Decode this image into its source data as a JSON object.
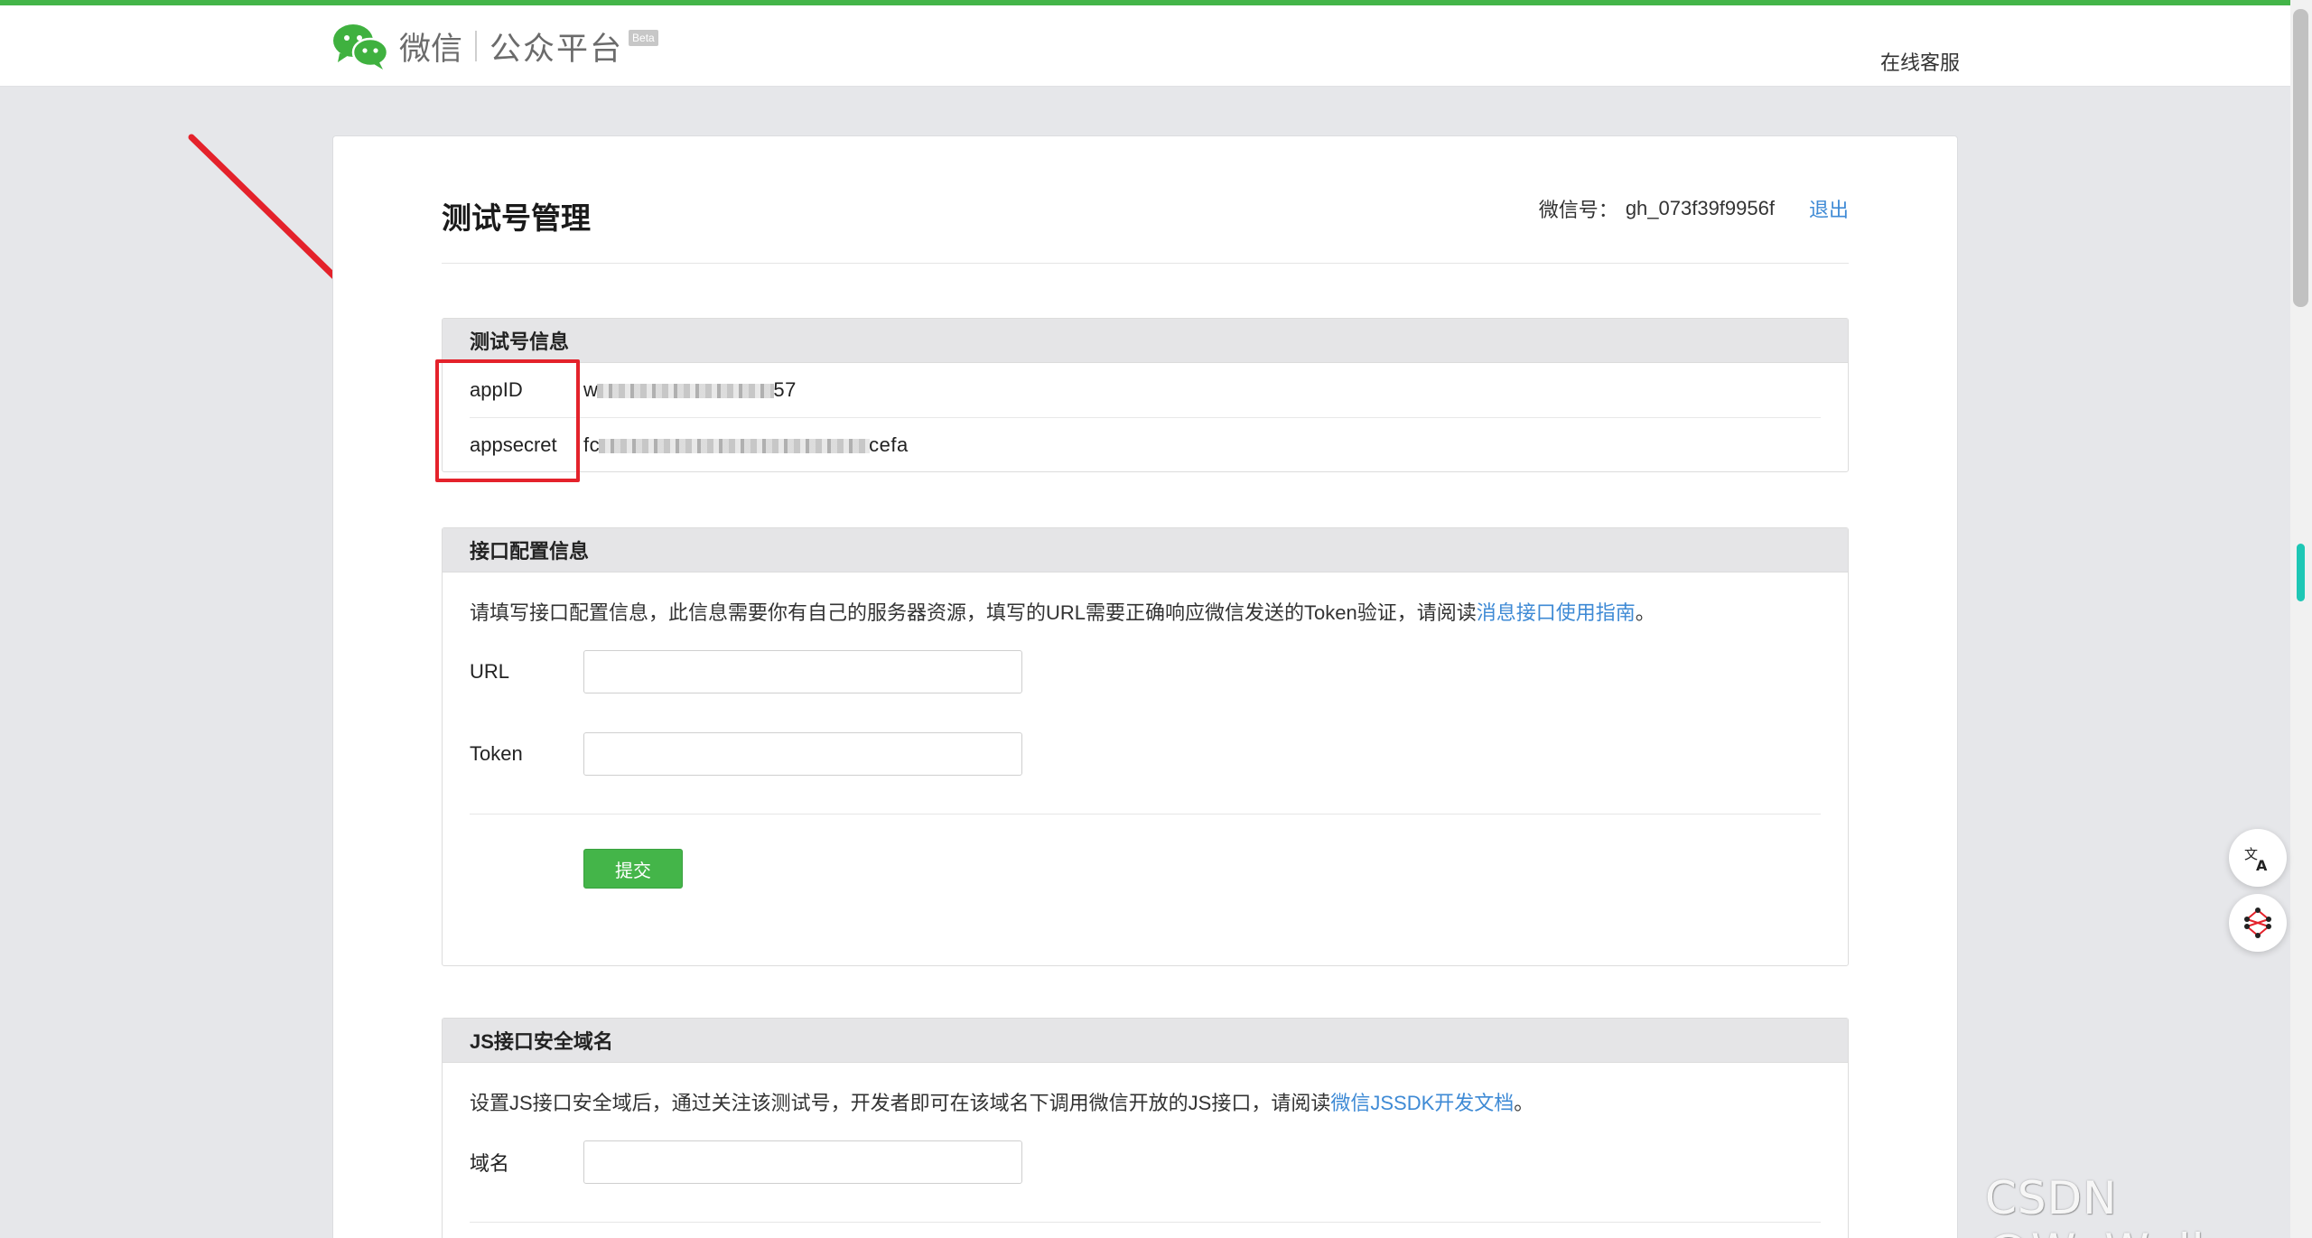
{
  "header": {
    "logo_wechat": "微信",
    "logo_platform": "公众平台",
    "logo_beta": "Beta",
    "service_link": "在线客服"
  },
  "page": {
    "title": "测试号管理",
    "account_label": "微信号：",
    "account_value": "gh_073f39f9956f",
    "logout": "退出"
  },
  "test_account": {
    "heading": "测试号信息",
    "appid_label": "appID",
    "appid_prefix": "w",
    "appid_suffix": "57",
    "appsecret_label": "appsecret",
    "appsecret_prefix": "fc",
    "appsecret_suffix": "cefa"
  },
  "interface_config": {
    "heading": "接口配置信息",
    "description": "请填写接口配置信息，此信息需要你有自己的服务器资源，填写的URL需要正确响应微信发送的Token验证，请阅读",
    "doc_link": "消息接口使用指南",
    "description_end": "。",
    "url_label": "URL",
    "url_value": "",
    "token_label": "Token",
    "token_value": "",
    "submit": "提交"
  },
  "js_domain": {
    "heading": "JS接口安全域名",
    "description": "设置JS接口安全域后，通过关注该测试号，开发者即可在该域名下调用微信开放的JS接口，请阅读",
    "doc_link": "微信JSSDK开发文档",
    "description_end": "。",
    "domain_label": "域名",
    "domain_value": ""
  },
  "watermark": "CSDN @WuWull",
  "colors": {
    "brand_green": "#44b549",
    "link_blue": "#3e8ad5",
    "annotation_red": "#e4222b"
  }
}
